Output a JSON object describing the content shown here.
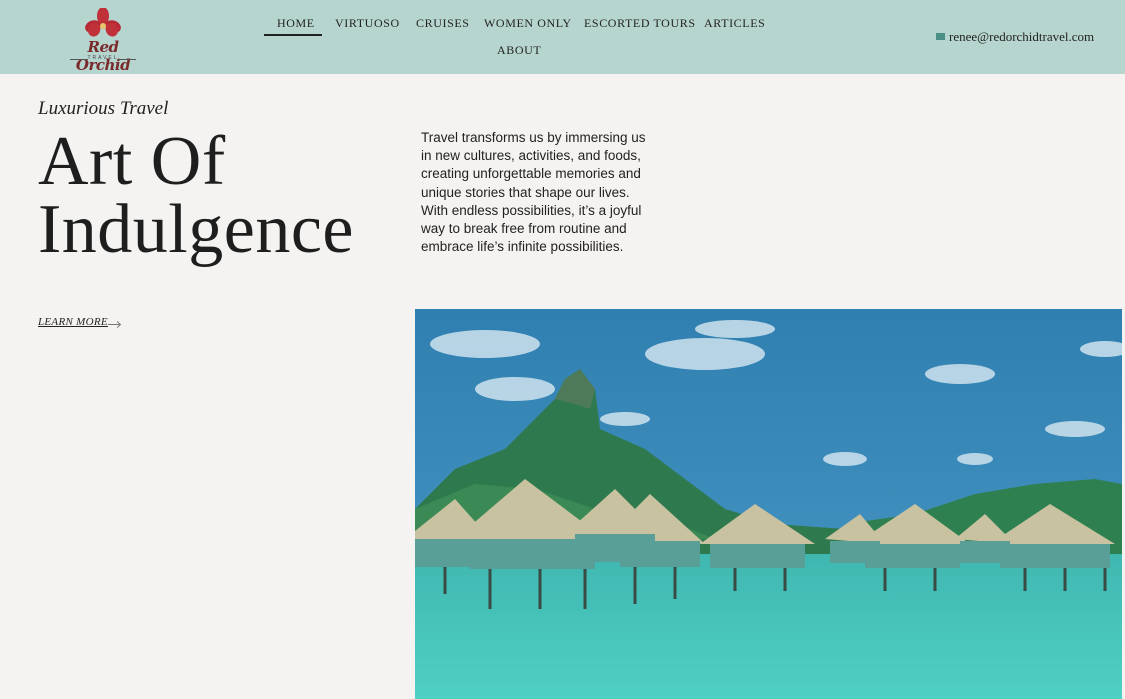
{
  "brand": {
    "name": "Red Orchid",
    "tagline": "TRAVEL"
  },
  "nav": {
    "items": [
      {
        "label": "HOME",
        "active": true
      },
      {
        "label": "VIRTUOSO"
      },
      {
        "label": "CRUISES"
      },
      {
        "label": "WOMEN ONLY"
      },
      {
        "label": "ESCORTED TOURS"
      },
      {
        "label": "ARTICLES"
      },
      {
        "label": "ABOUT"
      }
    ]
  },
  "contact": {
    "email": "renee@redorchidtravel.com",
    "icon": "mail-icon"
  },
  "hero": {
    "eyebrow": "Luxurious Travel",
    "title_line1": "Art Of",
    "title_line2": "Indulgence",
    "copy": "Travel transforms us by immersing us in new cultures, activities, and foods, creating unforgettable memories and unique stories that shape our lives. With endless possibilities, it’s a joyful way to break free from routine and embrace life’s infinite possibilities.",
    "cta": "LEARN MORE"
  },
  "colors": {
    "header_bg": "#b7d5cf",
    "page_bg": "#f4f3f1",
    "accent": "#4a8f86",
    "logo_red": "#c0313a"
  }
}
